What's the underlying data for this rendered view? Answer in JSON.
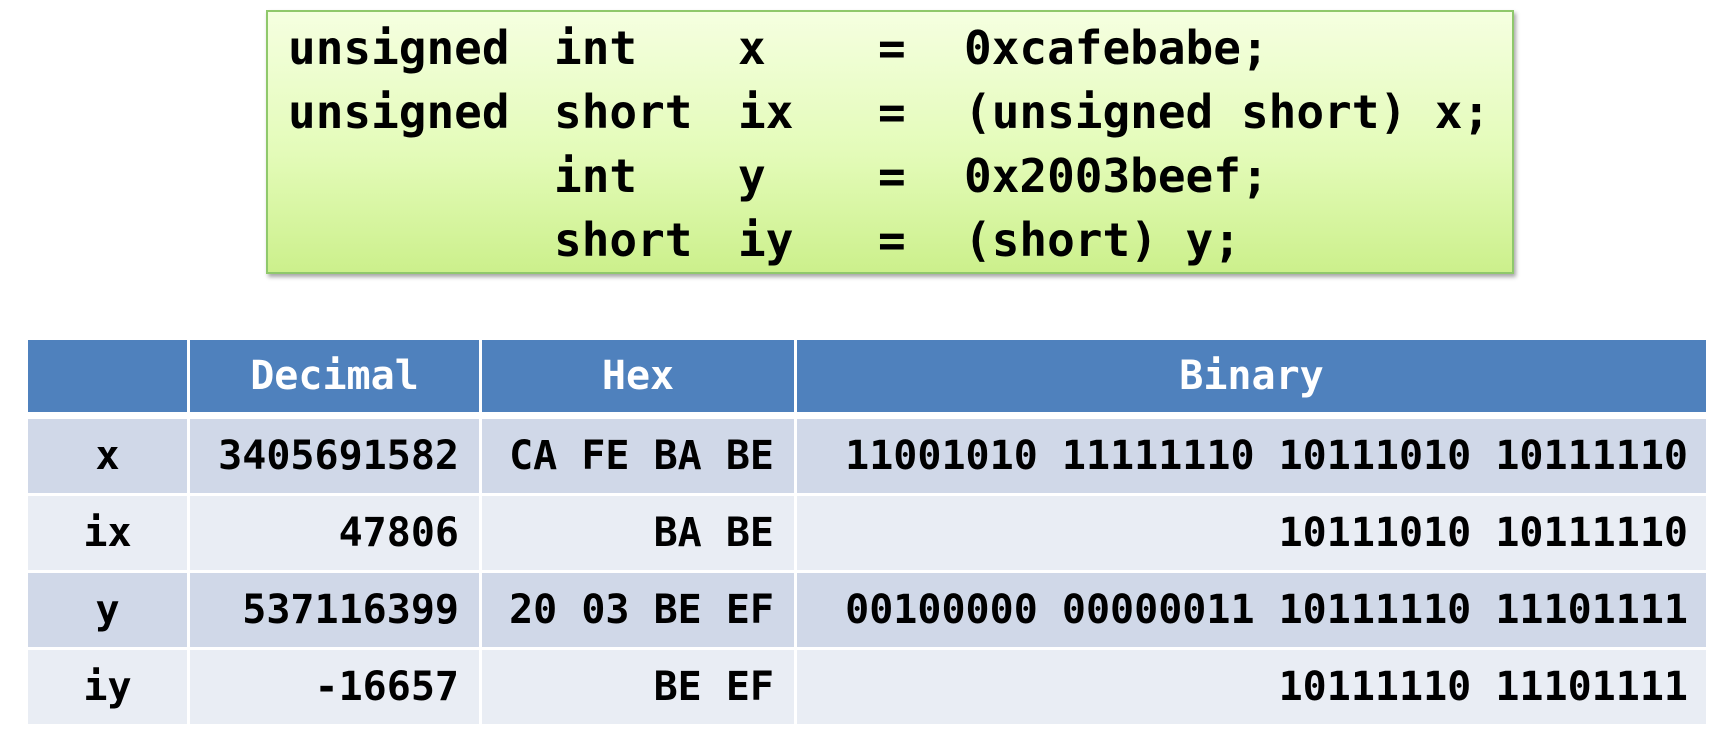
{
  "code": {
    "lines": [
      {
        "kw1": "unsigned",
        "kw2": "int",
        "var": "x",
        "eq": "=",
        "val": "0xcafebabe;"
      },
      {
        "kw1": "unsigned",
        "kw2": "short",
        "var": "ix",
        "eq": "=",
        "val": "(unsigned short) x;"
      },
      {
        "kw1": "",
        "kw2": "int",
        "var": "y",
        "eq": "=",
        "val": "0x2003beef;"
      },
      {
        "kw1": "",
        "kw2": "short",
        "var": "iy",
        "eq": "=",
        "val": "(short) y;"
      }
    ]
  },
  "table": {
    "headers": [
      "",
      "Decimal",
      "Hex",
      "Binary"
    ],
    "rows": [
      [
        "x",
        "3405691582",
        "CA FE BA BE",
        "11001010 11111110 10111010 10111110"
      ],
      [
        "ix",
        "47806",
        "BA BE",
        "10111010 10111110"
      ],
      [
        "y",
        "537116399",
        "20 03 BE EF",
        "00100000 00000011 10111110 11101111"
      ],
      [
        "iy",
        "-16657",
        "BE EF",
        "10111110 11101111"
      ]
    ]
  },
  "colors": {
    "header_bg": "#4f81bd",
    "band_dark": "#d0d8e8",
    "band_light": "#e9edf4",
    "code_border": "#8fc86b"
  }
}
